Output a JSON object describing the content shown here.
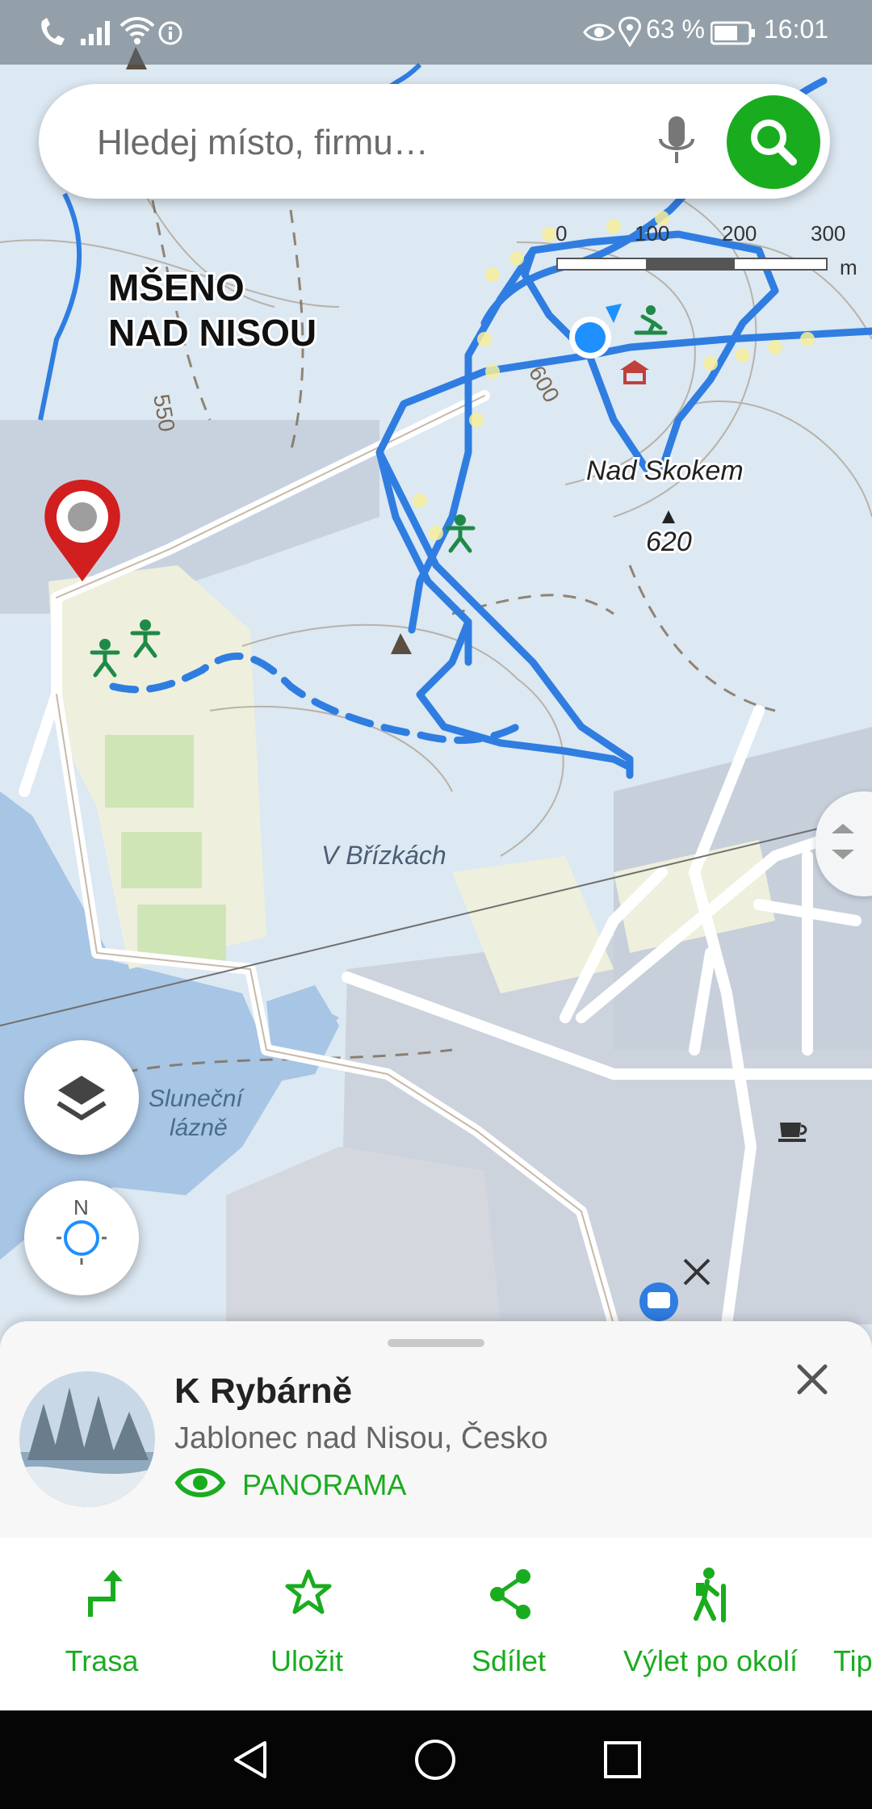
{
  "status_bar": {
    "battery": "63 %",
    "time": "16:01"
  },
  "search": {
    "placeholder": "Hledej místo, firmu…"
  },
  "map": {
    "scale": [
      "0",
      "100",
      "200",
      "300"
    ],
    "scale_unit": "m",
    "labels": {
      "town_line1": "MŠENO",
      "town_line2": "NAD NISOU",
      "peak": "Nad Skokem",
      "peak_elev": "620",
      "area": "V Břízkách",
      "lake_line1": "Sluneční",
      "lake_line2": "lázně",
      "contour_550": "550",
      "contour_600": "600"
    },
    "compass_letter": "N"
  },
  "place": {
    "title": "K Rybárně",
    "subtitle": "Jablonec nad Nisou, Česko",
    "panorama": "PANORAMA"
  },
  "actions": [
    {
      "label": "Trasa",
      "icon": "route-arrow-icon"
    },
    {
      "label": "Uložit",
      "icon": "star-icon"
    },
    {
      "label": "Sdílet",
      "icon": "share-icon"
    },
    {
      "label": "Výlet po okolí",
      "icon": "hiker-icon"
    },
    {
      "label": "Tip",
      "icon": "tip-icon"
    }
  ],
  "colors": {
    "accent": "#1aac1f",
    "route": "#2f7de1",
    "pin": "#d11f1f"
  }
}
